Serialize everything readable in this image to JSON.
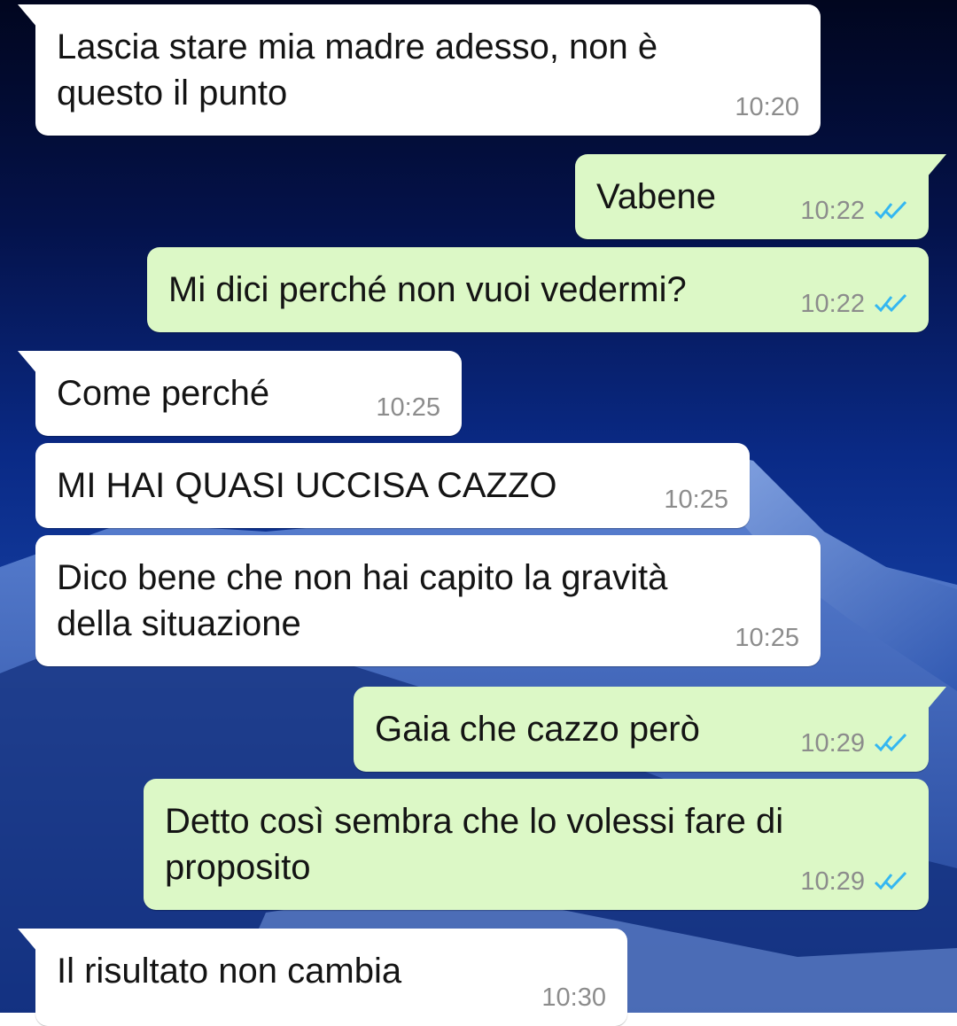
{
  "colors": {
    "incoming_bubble": "#ffffff",
    "outgoing_bubble": "#dcf8c6",
    "timestamp": "#8c8c8c",
    "read_ticks": "#34b7f1",
    "wallpaper": "#0a2a86"
  },
  "messages": [
    {
      "direction": "incoming",
      "text": "Lascia stare mia madre adesso, non è\nquesto il punto",
      "time": "10:20"
    },
    {
      "direction": "outgoing",
      "text": "Vabene",
      "time": "10:22",
      "status_icon": "double-check-icon"
    },
    {
      "direction": "outgoing",
      "text": "Mi dici perché non vuoi vedermi?",
      "time": "10:22",
      "status_icon": "double-check-icon"
    },
    {
      "direction": "incoming",
      "text": "Come perché",
      "time": "10:25"
    },
    {
      "direction": "incoming",
      "text": "MI HAI QUASI UCCISA CAZZO",
      "time": "10:25"
    },
    {
      "direction": "incoming",
      "text": "Dico bene che non hai capito la gravità\ndella situazione",
      "time": "10:25"
    },
    {
      "direction": "outgoing",
      "text": "Gaia che cazzo però",
      "time": "10:29",
      "status_icon": "double-check-icon"
    },
    {
      "direction": "outgoing",
      "text": "Detto così sembra che lo volessi fare di\nproposito",
      "time": "10:29",
      "status_icon": "double-check-icon"
    },
    {
      "direction": "incoming",
      "text": "Il risultato non cambia",
      "time": "10:30"
    }
  ]
}
